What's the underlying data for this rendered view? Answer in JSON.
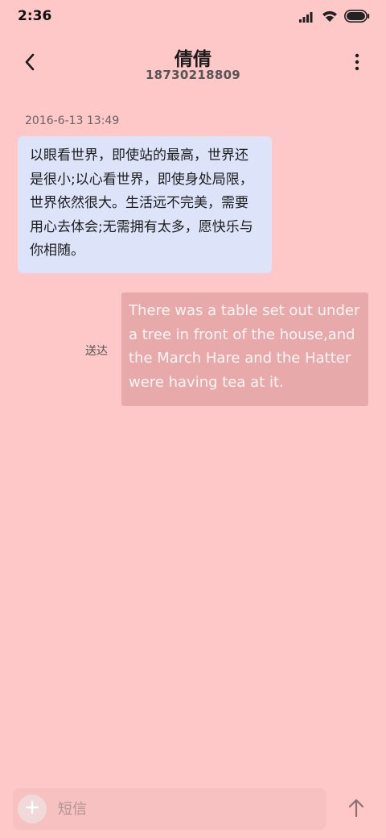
{
  "status_bar": {
    "time": "2:36",
    "icons": [
      "signal-icon",
      "wifi-icon",
      "battery-icon"
    ]
  },
  "header": {
    "contact_name": "倩倩",
    "contact_number": "18730218809",
    "icons": [
      "back-arrow-icon",
      "more-vertical-icon"
    ]
  },
  "conversation": {
    "timestamp": "2016-6-13 13:49",
    "incoming": {
      "text": "以眼看世界，即使站的最高，世界还是很小;以心看世界，即使身处局限，世界依然很大。生活远不完美，需要用心去体会;无需拥有太多，愿快乐与你相随。"
    },
    "outgoing": {
      "status": "送达",
      "text": "There was a table set out under a tree in front of the house,and the March Hare and the Hatter were having tea at it."
    }
  },
  "composer": {
    "placeholder": "短信",
    "value": "",
    "icons": [
      "plus-icon",
      "send-arrow-icon"
    ]
  },
  "colors": {
    "background": "#fec7c8",
    "incoming_bubble": "#dde3f8",
    "outgoing_bubble": "#e8a9ab"
  }
}
